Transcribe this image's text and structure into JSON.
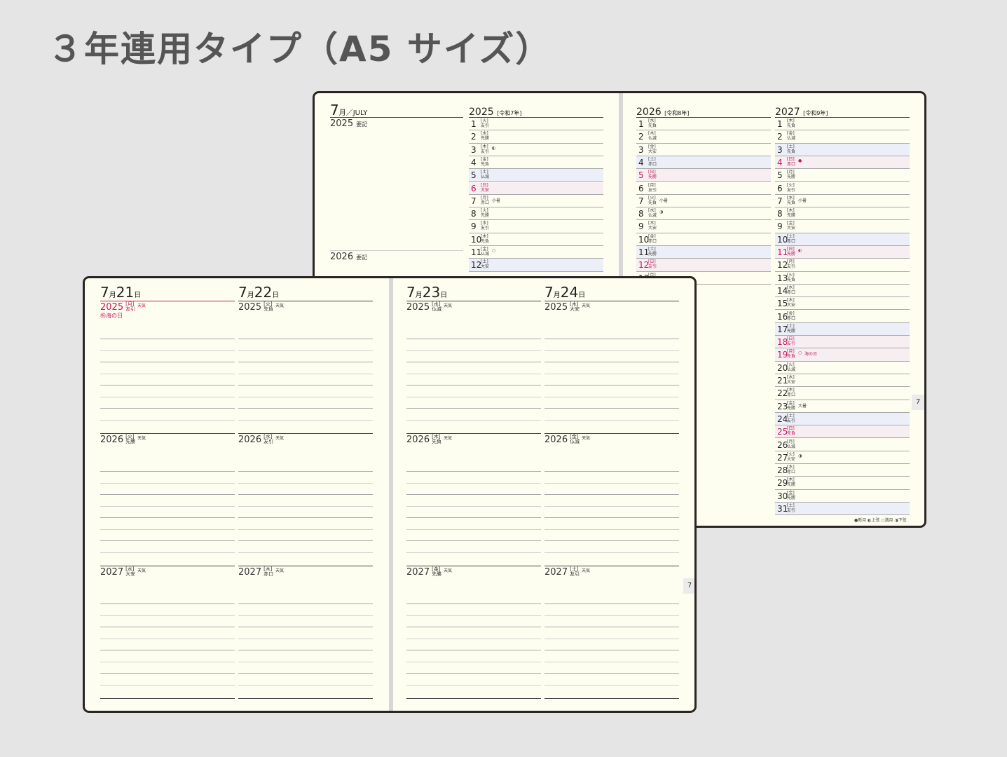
{
  "page_title": "３年連用タイプ（A5 サイズ）",
  "back_book": {
    "left_page": {
      "month_header": "7",
      "month_suffix": "月／JULY",
      "year_a": "2025",
      "year_a_label": "要記",
      "year_b": "2026",
      "year_b_label": "要記",
      "year_col_2025": "2025",
      "year_col_2025_era": "[令和7年]",
      "days_2025": [
        {
          "d": "1",
          "w": "[火]",
          "r": "友引",
          "n": ""
        },
        {
          "d": "2",
          "w": "[水]",
          "r": "先勝",
          "n": ""
        },
        {
          "d": "3",
          "w": "[木]",
          "r": "友引",
          "n": "◐"
        },
        {
          "d": "4",
          "w": "[金]",
          "r": "先負",
          "n": ""
        },
        {
          "d": "5",
          "w": "[土]",
          "r": "仏滅",
          "n": ""
        },
        {
          "d": "6",
          "w": "[日]",
          "r": "大安",
          "n": ""
        },
        {
          "d": "7",
          "w": "[月]",
          "r": "赤口",
          "n": "小暑"
        },
        {
          "d": "8",
          "w": "[火]",
          "r": "先勝",
          "n": ""
        },
        {
          "d": "9",
          "w": "[水]",
          "r": "友引",
          "n": ""
        },
        {
          "d": "10",
          "w": "[木]",
          "r": "先負",
          "n": ""
        },
        {
          "d": "11",
          "w": "[金]",
          "r": "仏滅",
          "n": "○"
        },
        {
          "d": "12",
          "w": "[土]",
          "r": "大安",
          "n": ""
        }
      ]
    },
    "right_page": {
      "year_col_2026": "2026",
      "year_col_2026_era": "[令和8年]",
      "year_col_2027": "2027",
      "year_col_2027_era": "[令和9年]",
      "days_2026": [
        {
          "d": "1",
          "w": "[水]",
          "r": "先負",
          "n": ""
        },
        {
          "d": "2",
          "w": "[木]",
          "r": "仏滅",
          "n": ""
        },
        {
          "d": "3",
          "w": "[金]",
          "r": "大安",
          "n": ""
        },
        {
          "d": "4",
          "w": "[土]",
          "r": "赤口",
          "n": ""
        },
        {
          "d": "5",
          "w": "[日]",
          "r": "先勝",
          "n": ""
        },
        {
          "d": "6",
          "w": "[月]",
          "r": "友引",
          "n": ""
        },
        {
          "d": "7",
          "w": "[火]",
          "r": "先負",
          "n": "小暑"
        },
        {
          "d": "8",
          "w": "[水]",
          "r": "仏滅",
          "n": "◑"
        },
        {
          "d": "9",
          "w": "[木]",
          "r": "大安",
          "n": ""
        },
        {
          "d": "10",
          "w": "[金]",
          "r": "赤口",
          "n": ""
        },
        {
          "d": "11",
          "w": "[土]",
          "r": "先勝",
          "n": ""
        },
        {
          "d": "12",
          "w": "[日]",
          "r": "友引",
          "n": ""
        },
        {
          "d": "13",
          "w": "[月]",
          "r": "",
          "n": ""
        }
      ],
      "days_2027": [
        {
          "d": "1",
          "w": "[木]",
          "r": "先負",
          "n": ""
        },
        {
          "d": "2",
          "w": "[金]",
          "r": "仏滅",
          "n": ""
        },
        {
          "d": "3",
          "w": "[土]",
          "r": "先負",
          "n": ""
        },
        {
          "d": "4",
          "w": "[日]",
          "r": "赤口",
          "n": "●"
        },
        {
          "d": "5",
          "w": "[月]",
          "r": "先勝",
          "n": ""
        },
        {
          "d": "6",
          "w": "[火]",
          "r": "友引",
          "n": ""
        },
        {
          "d": "7",
          "w": "[水]",
          "r": "先負",
          "n": "小暑"
        },
        {
          "d": "8",
          "w": "[木]",
          "r": "先勝",
          "n": ""
        },
        {
          "d": "9",
          "w": "[金]",
          "r": "大安",
          "n": ""
        },
        {
          "d": "10",
          "w": "[土]",
          "r": "赤口",
          "n": ""
        },
        {
          "d": "11",
          "w": "[日]",
          "r": "先勝",
          "n": "◐"
        },
        {
          "d": "12",
          "w": "[月]",
          "r": "友引",
          "n": ""
        },
        {
          "d": "13",
          "w": "[火]",
          "r": "先負",
          "n": ""
        },
        {
          "d": "14",
          "w": "[水]",
          "r": "赤口",
          "n": ""
        },
        {
          "d": "15",
          "w": "[木]",
          "r": "大安",
          "n": ""
        },
        {
          "d": "16",
          "w": "[金]",
          "r": "赤口",
          "n": ""
        },
        {
          "d": "17",
          "w": "[土]",
          "r": "先勝",
          "n": ""
        },
        {
          "d": "18",
          "w": "[日]",
          "r": "友引",
          "n": ""
        },
        {
          "d": "19",
          "w": "[月]",
          "r": "先負",
          "n": "○",
          "h": "海の日"
        },
        {
          "d": "20",
          "w": "[火]",
          "r": "仏滅",
          "n": ""
        },
        {
          "d": "21",
          "w": "[水]",
          "r": "大安",
          "n": ""
        },
        {
          "d": "22",
          "w": "[木]",
          "r": "赤口",
          "n": ""
        },
        {
          "d": "23",
          "w": "[金]",
          "r": "先勝",
          "n": "大暑"
        },
        {
          "d": "24",
          "w": "[土]",
          "r": "友引",
          "n": ""
        },
        {
          "d": "25",
          "w": "[日]",
          "r": "先負",
          "n": ""
        },
        {
          "d": "26",
          "w": "[月]",
          "r": "仏滅",
          "n": ""
        },
        {
          "d": "27",
          "w": "[火]",
          "r": "大安",
          "n": "◑"
        },
        {
          "d": "28",
          "w": "[水]",
          "r": "赤口",
          "n": ""
        },
        {
          "d": "29",
          "w": "[木]",
          "r": "先勝",
          "n": ""
        },
        {
          "d": "30",
          "w": "[金]",
          "r": "先勝",
          "n": ""
        },
        {
          "d": "31",
          "w": "[土]",
          "r": "友引",
          "n": ""
        }
      ],
      "tab": "7",
      "legend": "●新月 ◐上弦 ○満月 ◑下弦"
    }
  },
  "front_book": {
    "tab": "7",
    "columns": [
      {
        "month": "7",
        "month_unit": "月",
        "day": "21",
        "day_unit": "日",
        "years": [
          {
            "y": "2025",
            "w": "[月]",
            "r": "友引",
            "wx": "天気",
            "red": true,
            "holiday": "㊗海の日"
          },
          {
            "y": "2026",
            "w": "[火]",
            "r": "先勝",
            "wx": "天気"
          },
          {
            "y": "2027",
            "w": "[水]",
            "r": "大安",
            "wx": "天気"
          }
        ]
      },
      {
        "month": "7",
        "month_unit": "月",
        "day": "22",
        "day_unit": "日",
        "years": [
          {
            "y": "2025",
            "w": "[火]",
            "r": "先負",
            "wx": "天気"
          },
          {
            "y": "2026",
            "w": "[水]",
            "r": "友引",
            "wx": "天気"
          },
          {
            "y": "2027",
            "w": "[木]",
            "r": "赤口",
            "wx": "天気"
          }
        ]
      },
      {
        "month": "7",
        "month_unit": "月",
        "day": "23",
        "day_unit": "日",
        "years": [
          {
            "y": "2025",
            "w": "[水]",
            "r": "仏滅",
            "wx": "天気"
          },
          {
            "y": "2026",
            "w": "[木]",
            "r": "先負",
            "wx": "天気"
          },
          {
            "y": "2027",
            "w": "[金]",
            "r": "先勝",
            "wx": "天気"
          }
        ]
      },
      {
        "month": "7",
        "month_unit": "月",
        "day": "24",
        "day_unit": "日",
        "years": [
          {
            "y": "2025",
            "w": "[木]",
            "r": "大安",
            "wx": "天気"
          },
          {
            "y": "2026",
            "w": "[金]",
            "r": "仏滅",
            "wx": "天気"
          },
          {
            "y": "2027",
            "w": "[土]",
            "r": "友引",
            "wx": "天気"
          }
        ]
      }
    ]
  }
}
